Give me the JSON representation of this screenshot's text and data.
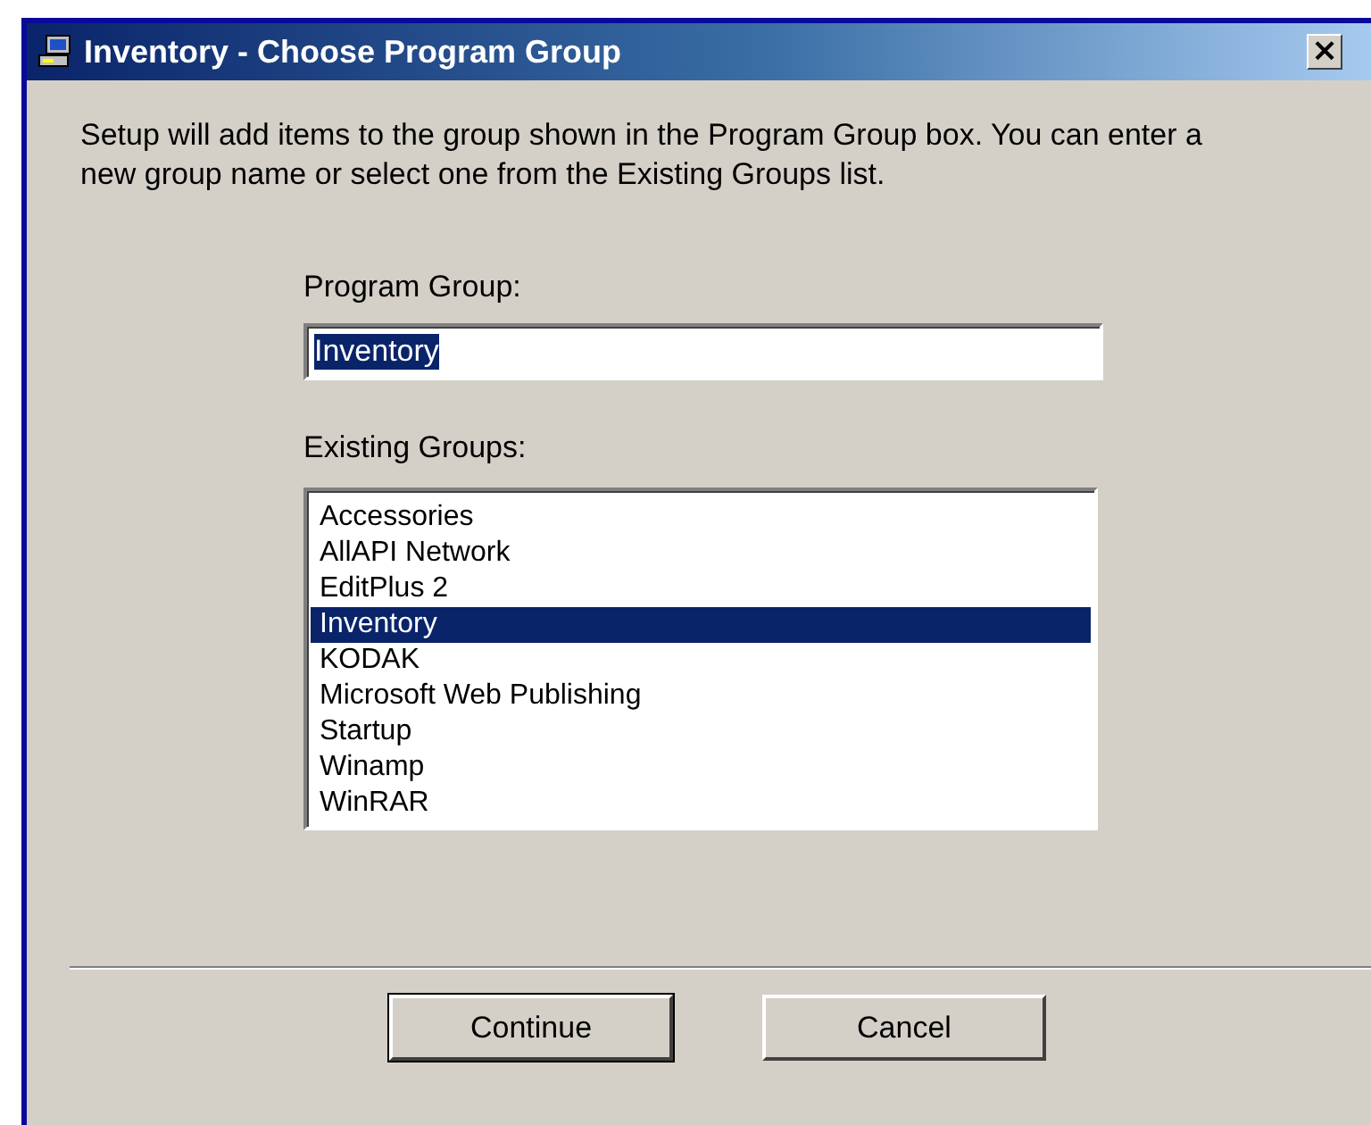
{
  "window": {
    "title": "Inventory - Choose Program Group",
    "close": "×"
  },
  "description": "Setup will add items to the group shown in the Program Group box. You can enter a new group name or select one from the Existing Groups list.",
  "program_group": {
    "label": "Program Group:",
    "value": "Inventory",
    "text_selected": true
  },
  "existing_groups": {
    "label": "Existing Groups:",
    "items": [
      {
        "label": "Accessories",
        "selected": false
      },
      {
        "label": "AllAPI Network",
        "selected": false
      },
      {
        "label": "EditPlus 2",
        "selected": false
      },
      {
        "label": "Inventory",
        "selected": true
      },
      {
        "label": "KODAK",
        "selected": false
      },
      {
        "label": "Microsoft Web Publishing",
        "selected": false
      },
      {
        "label": "Startup",
        "selected": false
      },
      {
        "label": "Winamp",
        "selected": false
      },
      {
        "label": "WinRAR",
        "selected": false
      }
    ]
  },
  "buttons": [
    {
      "label": "Continue",
      "default": true
    },
    {
      "label": "Cancel",
      "default": false
    }
  ]
}
